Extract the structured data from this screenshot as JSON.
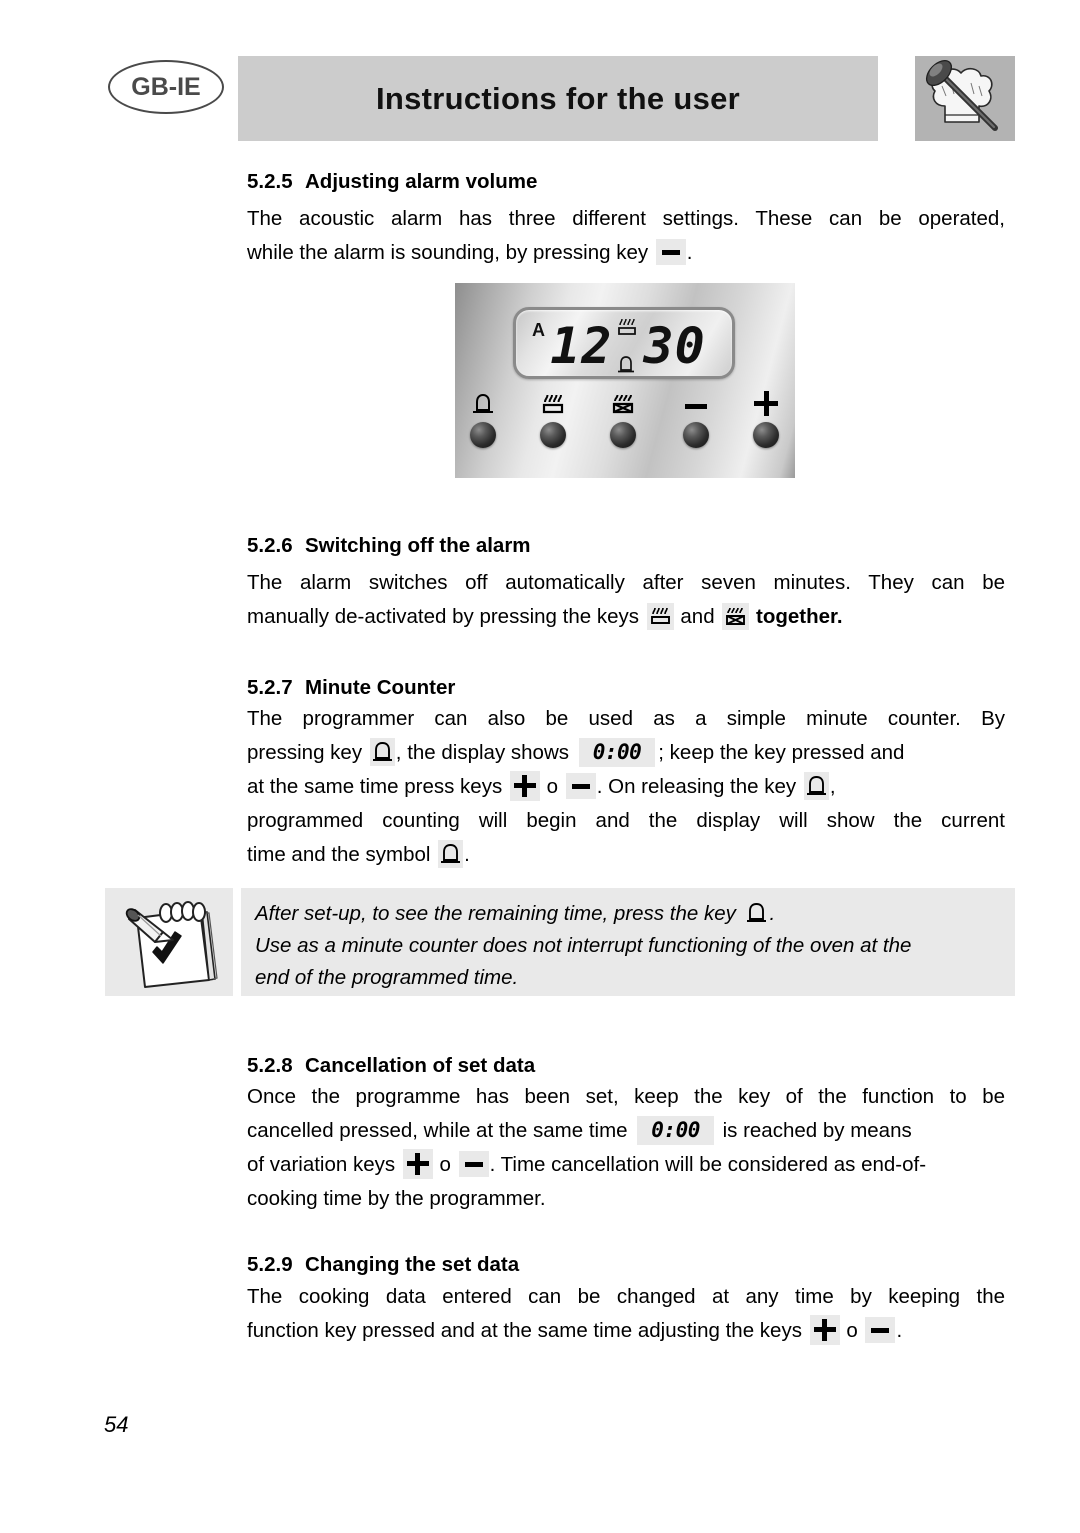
{
  "header": {
    "lang_badge": "GB-IE",
    "title": "Instructions for the user",
    "chef_icon_name": "chef-hat-spoon-icon"
  },
  "sections": [
    {
      "number": "5.2.5",
      "heading": "Adjusting alarm volume",
      "lines": [
        "The acoustic alarm has three different settings. These can be operated,",
        "while the alarm is sounding, by pressing key",
        "."
      ]
    },
    {
      "number": "5.2.6",
      "heading": "Switching off the alarm",
      "lines": [
        "The alarm switches off automatically after seven minutes. They can be",
        "manually de-activated by pressing the keys",
        "and",
        "together."
      ]
    },
    {
      "number": "5.2.7",
      "heading": "Minute Counter",
      "lines": [
        "The programmer can also be used as a simple minute counter. By",
        "pressing key",
        ", the display shows",
        "; keep the key pressed and",
        "at the same time press keys",
        "o",
        ". On releasing the key",
        ",",
        "programmed counting will begin and the display will show the current",
        "time and the symbol",
        "."
      ]
    },
    {
      "number": "5.2.8",
      "heading": "Cancellation of set data",
      "lines": [
        "Once the programme has been set, keep the key of the function to be",
        "cancelled pressed, while at the same time",
        "is reached by means",
        "of variation keys",
        "o",
        ". Time cancellation will be considered as end-of-",
        "cooking time by the programmer."
      ]
    },
    {
      "number": "5.2.9",
      "heading": "Changing the set data",
      "lines": [
        "The cooking data entered can be changed at any time by keeping the",
        "function key pressed and at the same time adjusting the keys",
        "o",
        "."
      ]
    }
  ],
  "control_panel": {
    "display_marker": "A",
    "display_time": "12 30",
    "display_hours": "12",
    "display_minutes": "30",
    "indicator_heat": "heating-element-symbol",
    "indicator_bell": "bell-symbol",
    "buttons": [
      {
        "name": "bell-button",
        "symbol": "bell"
      },
      {
        "name": "cooking-time-button",
        "symbol": "heating-element"
      },
      {
        "name": "end-of-cooking-button",
        "symbol": "heating-element-crossed"
      },
      {
        "name": "minus-button",
        "symbol": "minus"
      },
      {
        "name": "plus-button",
        "symbol": "plus"
      }
    ]
  },
  "note": {
    "icon_name": "notepad-pencil-check-icon",
    "lines": [
      "After set-up, to see the remaining time, press the key",
      ".",
      "Use as a minute counter does not interrupt functioning of the oven at the",
      "end of the programmed time."
    ]
  },
  "key_chips": {
    "display_zero": "0:00"
  },
  "footer": {
    "page_number": "54"
  },
  "colors": {
    "header_bar": "#cccccc",
    "chip_background": "#e9e9e9",
    "note_background": "#e9e9e9",
    "text": "#000000"
  }
}
